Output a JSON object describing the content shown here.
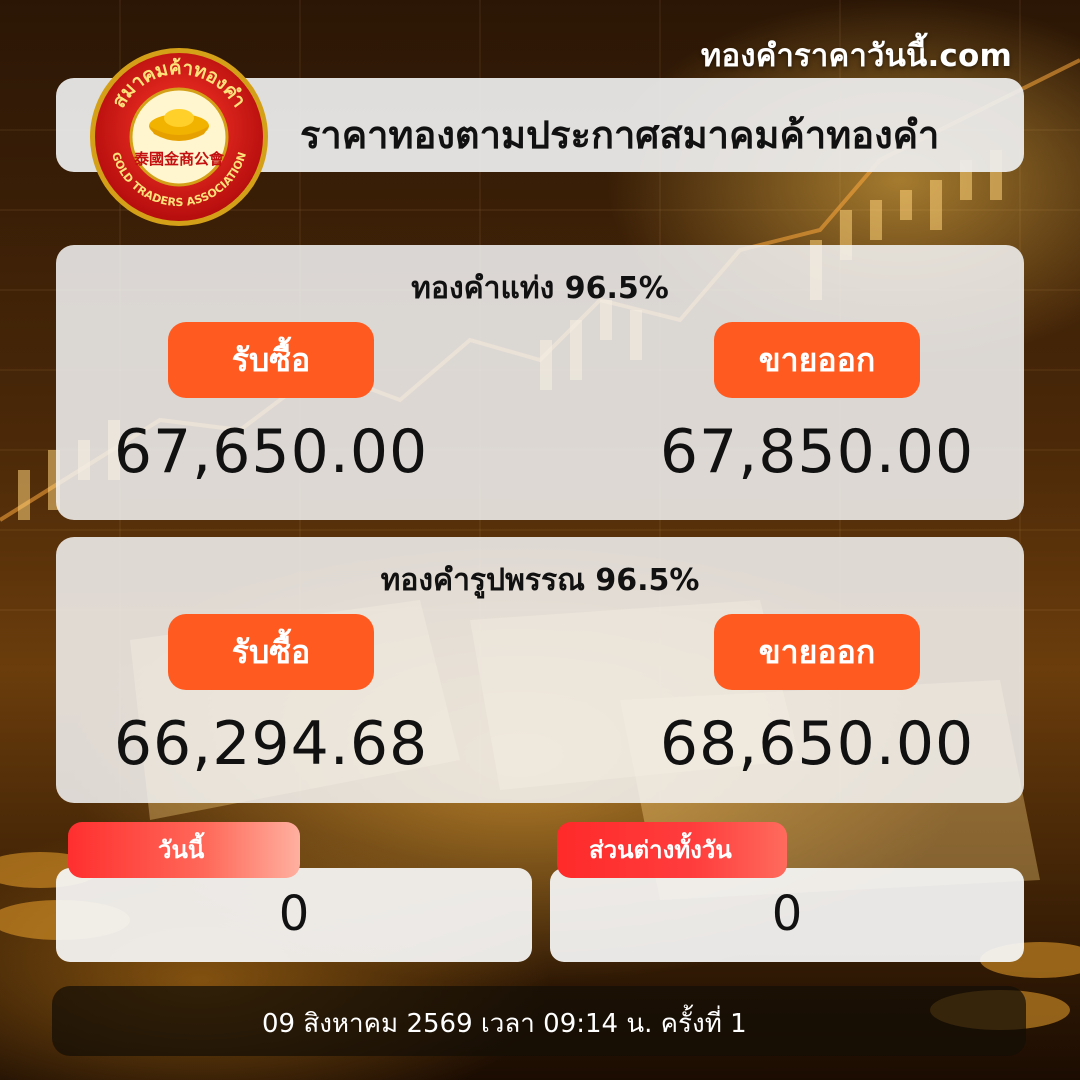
{
  "site": "ทองคำราคาวันนี้.com",
  "header": {
    "title": "ราคาทองตามประกาศสมาคมค้าทองคำ",
    "logo": {
      "thai_text": "สมาคมค้าทองคำ",
      "english_text": "GOLD TRADERS ASSOCIATION",
      "chinese_text": "泰國金商公會"
    }
  },
  "gold_bar": {
    "title": "ทองคำแท่ง 96.5%",
    "buy_label": "รับซื้อ",
    "sell_label": "ขายออก",
    "buy_price": "67,650.00",
    "sell_price": "67,850.00"
  },
  "gold_ornament": {
    "title": "ทองคำรูปพรรณ 96.5%",
    "buy_label": "รับซื้อ",
    "sell_label": "ขายออก",
    "buy_price": "66,294.68",
    "sell_price": "68,650.00"
  },
  "today": {
    "label": "วันนี้",
    "value": "0"
  },
  "daily_diff": {
    "label": "ส่วนต่างทั้งวัน",
    "value": "0"
  },
  "footer": {
    "text": "09 สิงหาคม 2569 เวลา 09:14 น. ครั้งที่ 1"
  },
  "colors": {
    "accent": "#ff5a1f",
    "tab_red": "#ff2f2f",
    "panel_bg": "#f4f4f4",
    "footer_bg": "#140e06"
  }
}
